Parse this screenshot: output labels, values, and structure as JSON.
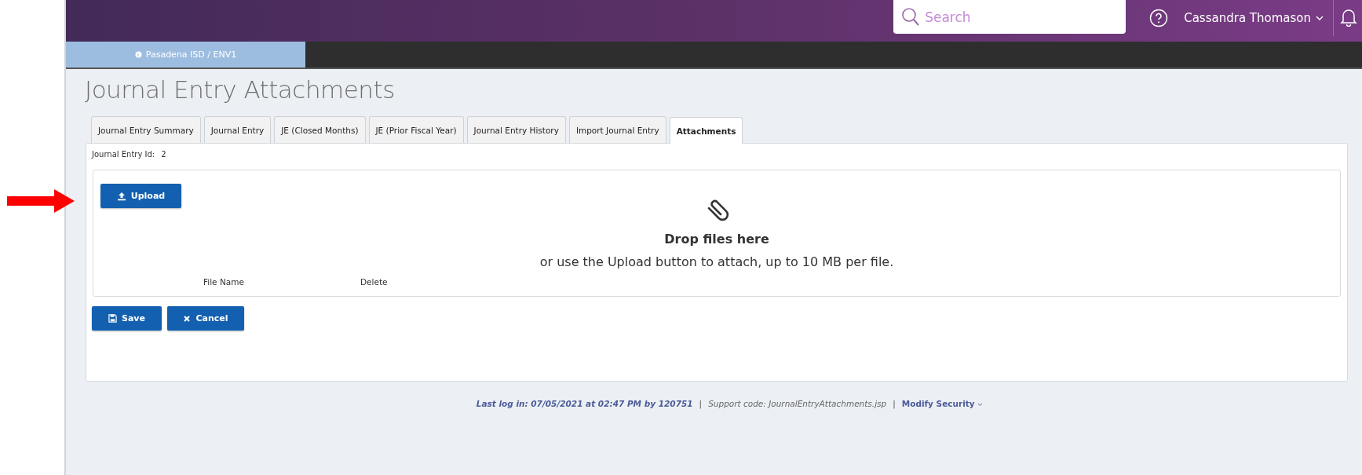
{
  "header": {
    "search": {
      "placeholder": "Search"
    },
    "user": "Cassandra Thomason"
  },
  "environment": {
    "label": "Pasadena ISD / ENV1"
  },
  "page_title": "Journal Entry Attachments",
  "tabs": [
    {
      "label": "Journal Entry Summary",
      "selected": false
    },
    {
      "label": "Journal Entry",
      "selected": false
    },
    {
      "label": "JE (Closed Months)",
      "selected": false
    },
    {
      "label": "JE (Prior Fiscal Year)",
      "selected": false
    },
    {
      "label": "Journal Entry History",
      "selected": false
    },
    {
      "label": "Import Journal Entry",
      "selected": false
    },
    {
      "label": "Attachments",
      "selected": true
    }
  ],
  "journal_entry_id": {
    "label": "Journal Entry Id:",
    "value": "2"
  },
  "dropzone": {
    "upload_button": "Upload",
    "heading": "Drop files here",
    "hint": "or use the Upload button to attach, up to 10 MB per file.",
    "columns": [
      "File Name",
      "Delete"
    ]
  },
  "buttons": [
    {
      "kind": "save",
      "label": "Save"
    },
    {
      "kind": "cancel",
      "label": "Cancel"
    }
  ],
  "footer": {
    "last_login": "Last log in: 07/05/2021 at 02:47 PM by 120751",
    "separator_1": "|",
    "support_code": "Support code: JournalEntryAttachments.jsp",
    "separator_2": "|",
    "modify_security": "Modify Security"
  }
}
